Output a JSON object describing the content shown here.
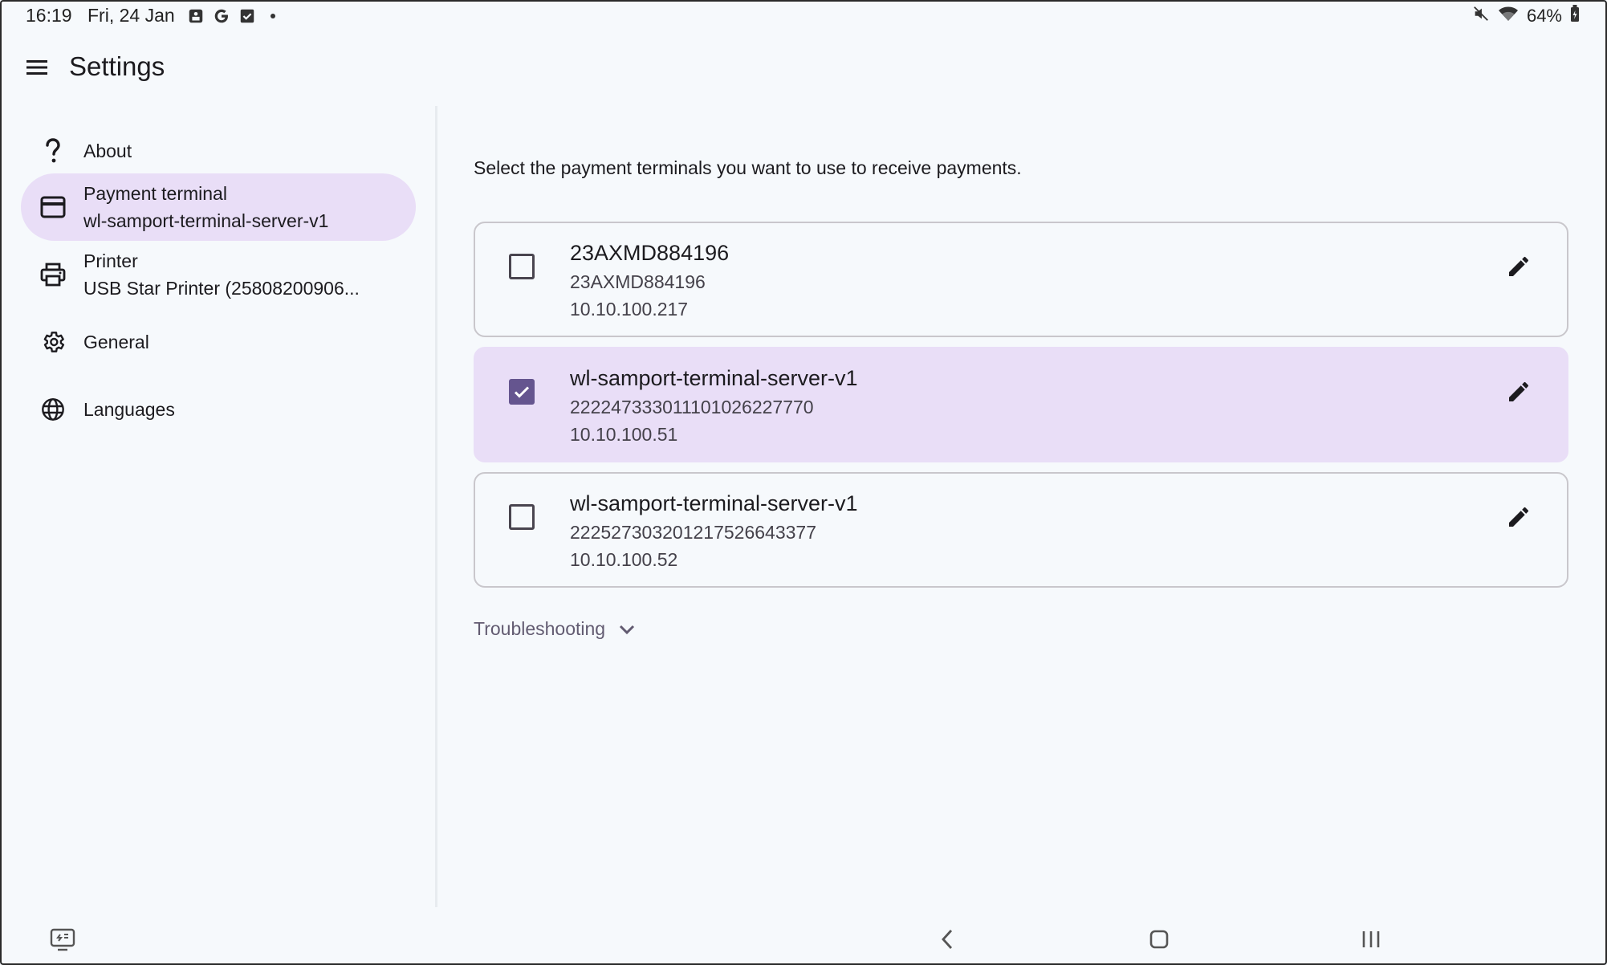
{
  "status_bar": {
    "time": "16:19",
    "date": "Fri, 24 Jan",
    "battery": "64%",
    "left_icons": [
      "screenshot-icon",
      "google-icon",
      "task-check-icon",
      "dot-icon"
    ],
    "right_icons": [
      "mute-icon",
      "wifi-icon",
      "battery-icon"
    ]
  },
  "app_bar": {
    "title": "Settings",
    "menu_icon": "menu-icon"
  },
  "sidebar": {
    "items": [
      {
        "label": "About",
        "sub": "",
        "icon": "help-icon",
        "active": false
      },
      {
        "label": "Payment terminal",
        "sub": "wl-samport-terminal-server-v1",
        "icon": "credit-card-icon",
        "active": true
      },
      {
        "label": "Printer",
        "sub": "USB Star Printer (25808200906...",
        "icon": "printer-icon",
        "active": false
      },
      {
        "label": "General",
        "sub": "",
        "icon": "gear-icon",
        "active": false
      },
      {
        "label": "Languages",
        "sub": "",
        "icon": "globe-icon",
        "active": false
      }
    ]
  },
  "content": {
    "intro": "Select the payment terminals you want to use to receive payments.",
    "terminals": [
      {
        "name": "23AXMD884196",
        "serial": "23AXMD884196",
        "ip": "10.10.100.217",
        "selected": false
      },
      {
        "name": "wl-samport-terminal-server-v1",
        "serial": "222247333011101026227770",
        "ip": "10.10.100.51",
        "selected": true
      },
      {
        "name": "wl-samport-terminal-server-v1",
        "serial": "222527303201217526643377",
        "ip": "10.10.100.52",
        "selected": false
      }
    ],
    "troubleshooting_label": "Troubleshooting"
  },
  "colors": {
    "accent": "#65558f",
    "selected_bg": "#e9def7",
    "background": "#f6f9fc"
  },
  "nav_bar": {
    "buttons": [
      "keyboard-switch-icon",
      "back-icon",
      "home-icon",
      "recents-icon"
    ]
  }
}
